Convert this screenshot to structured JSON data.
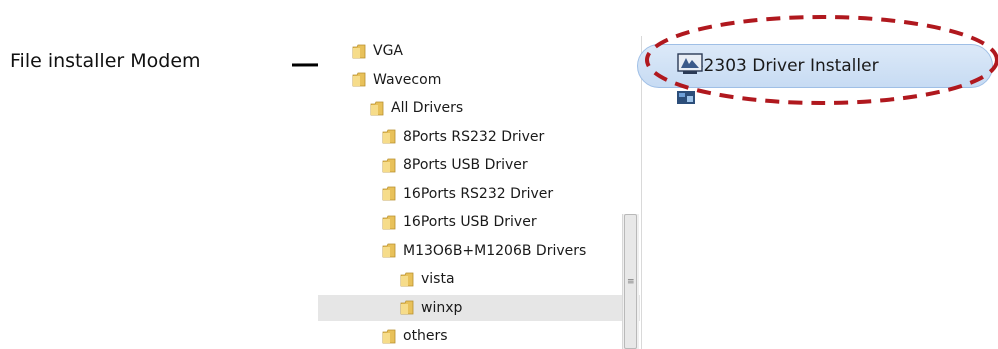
{
  "annotation": {
    "label": "File installer Modem"
  },
  "folder_tree": {
    "items": [
      {
        "label": "VGA",
        "depth": 0
      },
      {
        "label": "Wavecom",
        "depth": 0
      },
      {
        "label": "All  Drivers",
        "depth": 1
      },
      {
        "label": "8Ports RS232 Driver",
        "depth": 2
      },
      {
        "label": "8Ports USB Driver",
        "depth": 2
      },
      {
        "label": "16Ports RS232 Driver",
        "depth": 2
      },
      {
        "label": "16Ports USB Driver",
        "depth": 2
      },
      {
        "label": "M13O6B+M1206B Drivers",
        "depth": 2
      },
      {
        "label": "vista",
        "depth": 3
      },
      {
        "label": "winxp",
        "depth": 3,
        "selected": true
      },
      {
        "label": "others",
        "depth": 2
      }
    ],
    "selected_item": "winxp"
  },
  "file_list": {
    "items": [
      {
        "label": "PL-2303 Driver Installer",
        "icon": "installer-icon",
        "highlighted": true
      }
    ]
  },
  "colors": {
    "highlight_ellipse": "#b0181e",
    "selected_file_bg": "#cfe0f5",
    "selected_folder_bg": "#e6e6e6",
    "folder_yellow": "#e8c15a"
  }
}
